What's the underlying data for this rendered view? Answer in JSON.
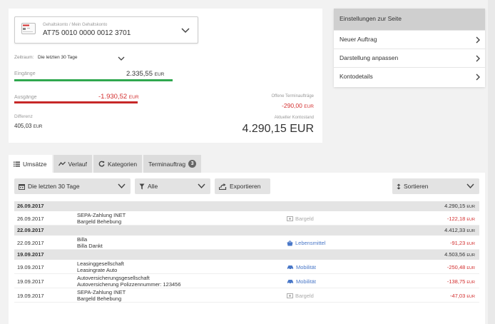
{
  "account": {
    "label": "Gehaltskonto / Mein Gehaltskonto",
    "iban": "AT75 0010 0000 0012 3701"
  },
  "period": {
    "label": "Zeitraum:",
    "value": "Die letzten 30 Tage"
  },
  "incoming": {
    "label": "Eingänge",
    "amount": "2.335,55",
    "currency": "EUR",
    "bar_fraction": 0.77
  },
  "outgoing": {
    "label": "Ausgänge",
    "amount": "-1.930,52",
    "currency": "EUR",
    "bar_fraction": 0.6
  },
  "difference": {
    "label": "Differenz",
    "amount": "405,03",
    "currency": "EUR"
  },
  "open_orders": {
    "label": "Offene Terminaufträge",
    "amount": "-290,00",
    "currency": "EUR"
  },
  "balance": {
    "label": "Aktueller Kontostand",
    "amount": "4.290,15 EUR"
  },
  "settings": {
    "title": "Einstellungen zur Seite",
    "items": [
      {
        "label": "Neuer Auftrag"
      },
      {
        "label": "Darstellung anpassen"
      },
      {
        "label": "Kontodetails"
      }
    ]
  },
  "tabs": [
    {
      "label": "Umsätze",
      "icon": "list-icon",
      "active": true
    },
    {
      "label": "Verlauf",
      "icon": "trend-icon"
    },
    {
      "label": "Kategorien",
      "icon": "refresh-icon"
    },
    {
      "label": "Terminauftrag",
      "badge": "3"
    }
  ],
  "toolbar": {
    "period": "Die letzten 30 Tage",
    "filter": "Alle",
    "export": "Exportieren",
    "sort": "Sortieren"
  },
  "transactions": [
    {
      "date": "26.09.2017",
      "balance": "4.290,15",
      "items": [
        {
          "date": "26.09.2017",
          "line1": "SEPA-Zahlung INET",
          "line2": "Bargeld Behebung",
          "category": "Bargeld",
          "category_style": "muted",
          "amount": "-122,18"
        }
      ]
    },
    {
      "date": "22.09.2017",
      "balance": "4.412,33",
      "items": [
        {
          "date": "22.09.2017",
          "line1": "Billa",
          "line2": "Billa Dankt",
          "category": "Lebensmittel",
          "category_style": "blue",
          "amount": "-91,23"
        }
      ]
    },
    {
      "date": "19.09.2017",
      "balance": "4.503,56",
      "items": [
        {
          "date": "19.09.2017",
          "line1": "Leasinggesellschaft",
          "line2": "Leasingrate Auto",
          "category": "Mobilität",
          "category_style": "blue",
          "amount": "-250,48"
        },
        {
          "date": "19.09.2017",
          "line1": "Autoversicherungsgesellschaft",
          "line2": "Autoversicherung Polizzennummer: 123456",
          "category": "Mobilität",
          "category_style": "blue",
          "amount": "-138,75"
        },
        {
          "date": "19.09.2017",
          "line1": "SEPA-Zahlung INET",
          "line2": "Bargeld Behebung",
          "category": "Bargeld",
          "category_style": "muted",
          "amount": "-47,03"
        }
      ]
    }
  ],
  "currency": "EUR",
  "colors": {
    "income": "#2fa84f",
    "expense": "#c62828",
    "negative_text": "#d32f2f",
    "category_blue": "#4a78c8"
  }
}
